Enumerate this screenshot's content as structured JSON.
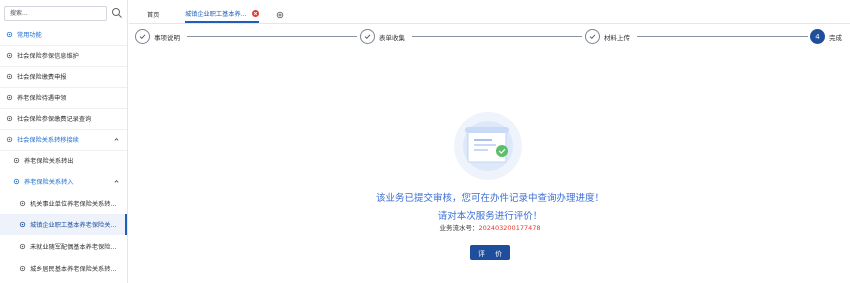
{
  "sidebar": {
    "search_placeholder": "搜索...",
    "items": [
      {
        "label": "常用功能"
      },
      {
        "label": "社会保险参保信息维护"
      },
      {
        "label": "社会保险缴费申报"
      },
      {
        "label": "养老保险待遇申领"
      },
      {
        "label": "社会保险参保缴费记录查询"
      },
      {
        "label": "社会保险关系转移接续"
      },
      {
        "label": "养老保险关系转出"
      },
      {
        "label": "养老保险关系转入"
      },
      {
        "label": "机关事业单位养老保险关系转..."
      },
      {
        "label": "城镇企业职工基本养老保险关..."
      },
      {
        "label": "未就业随军配偶基本养老保险..."
      },
      {
        "label": "城乡居民基本养老保险关系转..."
      }
    ]
  },
  "tabs": {
    "home": "首页",
    "active": "城镇企业职工基本养..."
  },
  "steps": [
    {
      "label": "事项说明"
    },
    {
      "label": "表单收集"
    },
    {
      "label": "材料上传"
    },
    {
      "number": "4",
      "label": "完成"
    }
  ],
  "result": {
    "line1": "该业务已提交审核，您可在办件记录中查询办理进度！",
    "line2": "请对本次服务进行评价！",
    "serial_label": "业务流水号：",
    "serial_value": "2024032001774​78",
    "rate_button": "评 价"
  },
  "colors": {
    "primary": "#1f4f9c",
    "accent_blue": "#3b6fd6",
    "danger": "#e53935"
  }
}
